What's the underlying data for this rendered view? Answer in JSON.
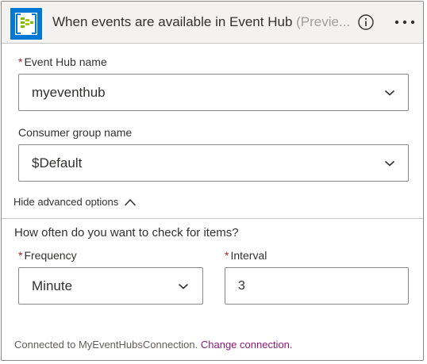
{
  "header": {
    "title": "When events are available in Event Hub",
    "preview": "(Previe...",
    "icon": "event-hub-icon",
    "info_icon": "info-icon",
    "more_icon": "more-options-icon",
    "brand_color": "#0078d4"
  },
  "fields": {
    "event_hub_name": {
      "required_mark": "*",
      "label": "Event Hub name",
      "value": "myeventhub"
    },
    "consumer_group": {
      "label": "Consumer group name",
      "value": "$Default"
    }
  },
  "advanced": {
    "toggle_label": "Hide advanced options",
    "question": "How often do you want to check for items?",
    "frequency": {
      "required_mark": "*",
      "label": "Frequency",
      "value": "Minute"
    },
    "interval": {
      "required_mark": "*",
      "label": "Interval",
      "value": "3"
    }
  },
  "footer": {
    "connected_text": "Connected to MyEventHubsConnection.",
    "change_link": "Change connection."
  },
  "colors": {
    "required": "#a4262c",
    "link": "#8a1b7a"
  }
}
